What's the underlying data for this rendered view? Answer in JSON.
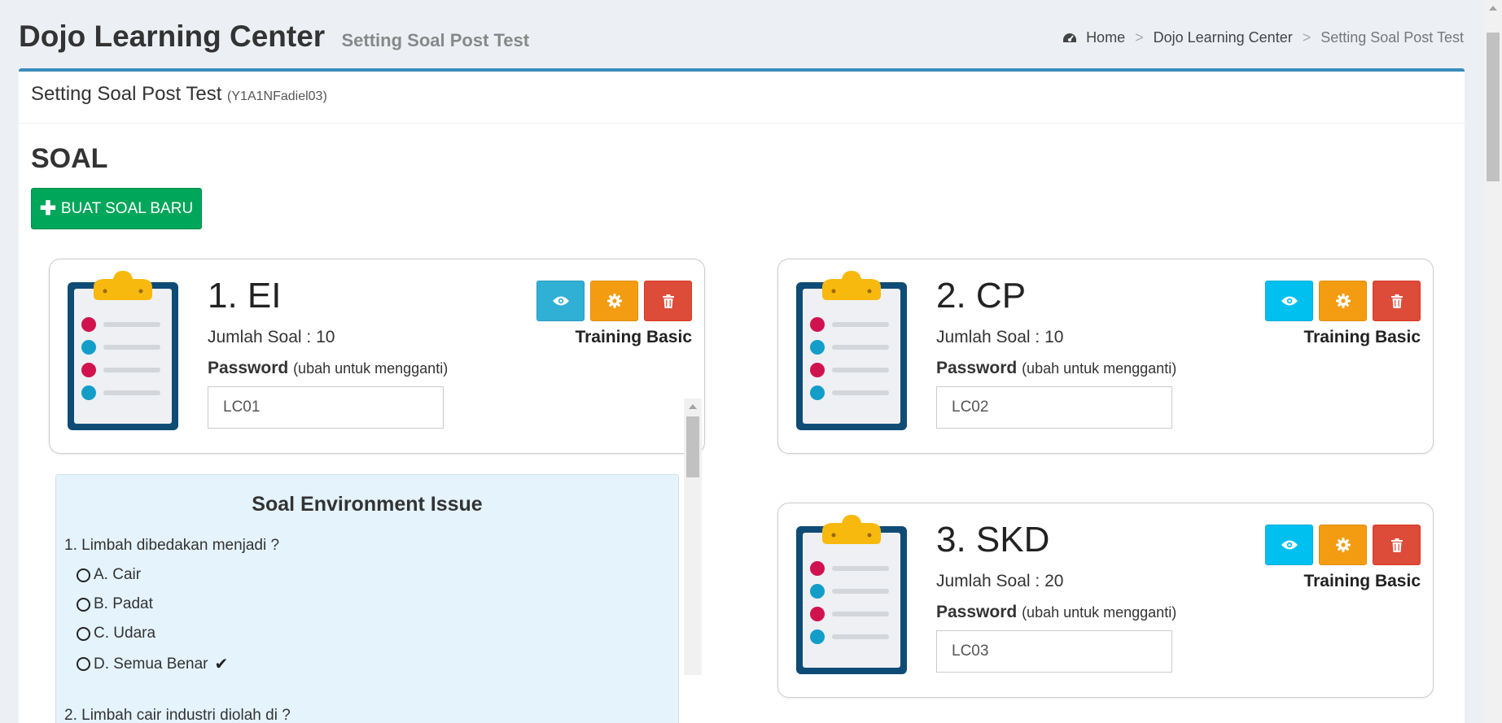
{
  "header": {
    "title": "Dojo Learning Center",
    "subtitle": "Setting Soal Post Test"
  },
  "breadcrumb": {
    "home_icon": "dashboard-icon",
    "items": [
      "Home",
      "Dojo Learning Center",
      "Setting Soal Post Test"
    ],
    "separator": ">"
  },
  "box": {
    "title": "Setting Soal Post Test",
    "code": "(Y1A1NFadiel03)"
  },
  "soal_heading": "SOAL",
  "new_button": {
    "icon": "plus-icon",
    "label": "BUAT SOAL BARU"
  },
  "cards": [
    {
      "number": "1. EI",
      "jumlah": "Jumlah Soal : 10",
      "password_label": "Password",
      "password_hint": "(ubah untuk mengganti)",
      "password_value": "LC01",
      "category": "Training Basic"
    },
    {
      "number": "2. CP",
      "jumlah": "Jumlah Soal : 10",
      "password_label": "Password",
      "password_hint": "(ubah untuk mengganti)",
      "password_value": "LC02",
      "category": "Training Basic"
    },
    {
      "number": "3. SKD",
      "jumlah": "Jumlah Soal : 20",
      "password_label": "Password",
      "password_hint": "(ubah untuk mengganti)",
      "password_value": "LC03",
      "category": "Training Basic"
    }
  ],
  "quiz": {
    "title": "Soal Environment Issue",
    "questions": [
      {
        "text": "1. Limbah dibedakan menjadi ?",
        "options": [
          "A. Cair",
          "B. Padat",
          "C. Udara",
          "D. Semua Benar"
        ],
        "correct": "D. Semua Benar"
      },
      {
        "text": "2. Limbah cair industri diolah di ?"
      }
    ]
  },
  "colors": {
    "primary_border": "#3c8dbc",
    "success": "#00a65a",
    "info": "#00c0ef",
    "warning": "#f39c12",
    "danger": "#dd4b39",
    "quiz_bg": "#e4f3fc"
  }
}
